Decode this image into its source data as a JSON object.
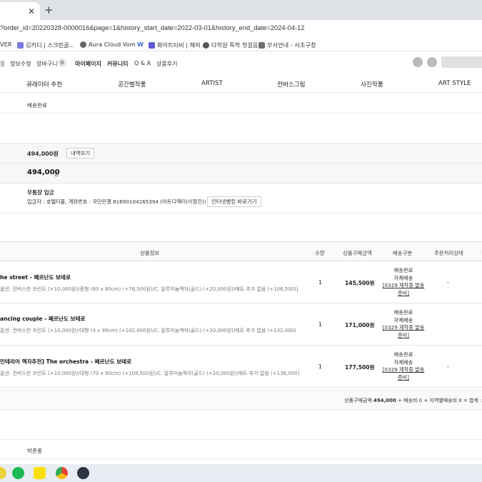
{
  "browser": {
    "close_glyph": "✕",
    "new_tab_glyph": "+",
    "url": "?order_id=20220328-0000016&page=1&history_start_date=2022-03-01&history_end_date=2024-04-12",
    "bookmarks": [
      {
        "label": "VER",
        "icon": "naver-icon",
        "color": "#ffffff"
      },
      {
        "label": "김카디 | 스크린골...",
        "icon": "link-icon",
        "color": "#7a7adf"
      },
      {
        "label": "Aura Cloud Vom",
        "icon": "globe-icon",
        "color": "#666666"
      },
      {
        "label": "W",
        "icon": "w-icon",
        "color": "#3b6fd8"
      },
      {
        "label": "화이트티비 | 해외...",
        "icon": "tv-icon",
        "color": "#5e5ad6"
      },
      {
        "label": "다학원 특학 첫걸음",
        "icon": "globe-icon",
        "color": "#555555"
      },
      {
        "label": "부서안내 - 서초구청",
        "icon": "folder-icon",
        "color": "#6f6f6f"
      }
    ]
  },
  "site_top": {
    "links": [
      "웃",
      "정보수정",
      "장바구니",
      "마이페이지",
      "커뮤니티",
      "Q & A",
      "상품후기"
    ],
    "cart_count": "0"
  },
  "gnb": [
    "큐레이터 추천",
    "공간별작품",
    "ARTIST",
    "컨버스그림",
    "사진작품",
    "ART STYLE"
  ],
  "order_status": "배송완료",
  "payment": {
    "amount": "494,000원",
    "detail_button": "내역보기",
    "total_value": "494,000",
    "total_unit": "원",
    "method": "무통장 입금",
    "deposit_info": "입금자 : 호텔티플, 계좌번호 : 국민은행 81690104165394 (아트디렉터(이정진))",
    "bank_button": "인터넷뱅킹 바로가기"
  },
  "table": {
    "headers": [
      "상품정보",
      "수량",
      "상품구매금액",
      "배송구분",
      "주문처리상태"
    ],
    "rows": [
      {
        "name": "he street - 페르난도 보테로",
        "option": "옵션: 컨버스천 프린트 (+10,000원)/중형 (60 x 80cm) (+76,500원)/C. 알루미늄액자(골드) (+20,000원)/매트 추가 없음 (+106,500)]",
        "qty": "1",
        "amount": "145,500원",
        "ship": [
          "배송완료",
          "자체배송"
        ],
        "ship_link": [
          "[0329 제작중 발송",
          "준비]"
        ],
        "state": "-"
      },
      {
        "name": "ancing couple - 페르난도 보테로",
        "option": "옵션: 컨버스천 프린트 (+10,000원)/대형 (4 x 90cm) (+102,000원)/C. 알루미늄액자(골드) (+20,000원)/매트 추가 없음 (+132,000)",
        "qty": "1",
        "amount": "171,000원",
        "ship": [
          "배송완료",
          "자체배송"
        ],
        "ship_link": [
          "[0329 제작중 발송",
          "준비]"
        ],
        "state": ""
      },
      {
        "name": "인테리어 액자추천] The orchestra - 페르난도 보테로",
        "option": "옵션: 컨버스천 프린트 (+10,000원)/대형 (70 x 90cm) (+108,500원)/C. 알루미늄액자(골드) (+20,000원)/매트 추가 없음 (+138,500)",
        "qty": "1",
        "amount": "177,500원",
        "ship": [
          "배송완료",
          "자체배송"
        ],
        "ship_link": [
          "[0329 제작중 발송",
          "준비]"
        ],
        "state": "-"
      }
    ],
    "summary_prefix": "상품구매금액",
    "summary_amount": "494,000",
    "summary_rest": "+ 배송비 0 + 지역별배송비 0 = 합계 :"
  },
  "recipient": "박준홍",
  "taskbar": [
    {
      "icon": "spotify-icon",
      "color": "#1db954"
    },
    {
      "icon": "kakaotalk-icon",
      "color": "#f9e000"
    },
    {
      "icon": "chrome-icon",
      "color": "#4285f4"
    },
    {
      "icon": "app-icon",
      "color": "#2b3440"
    }
  ]
}
